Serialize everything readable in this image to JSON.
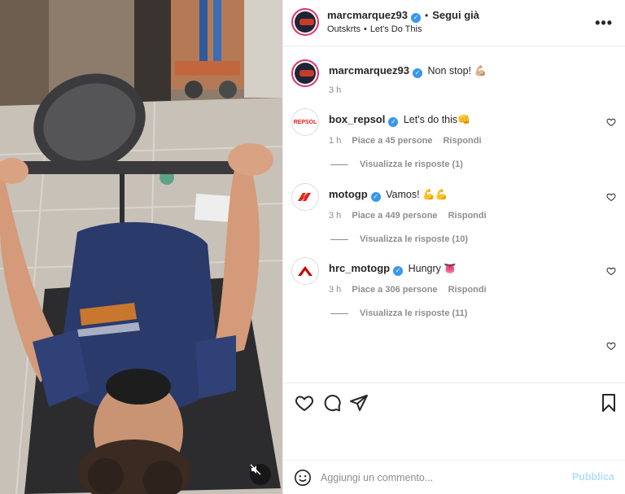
{
  "post": {
    "username": "marcmarquez93",
    "follow_label": "Segui già",
    "location": "Outskrts",
    "audio": "Let's Do This",
    "more_label": "•••"
  },
  "caption": {
    "username": "marcmarquez93",
    "text": "Non stop! 💪🏼",
    "time": "3 h"
  },
  "comments": [
    {
      "username": "box_repsol",
      "text": "Let's do this👊",
      "time": "1 h",
      "likes": "Piace a 45 persone",
      "reply": "Rispondi",
      "view_replies": "Visualizza le risposte (1)",
      "avatar_text": "REPSOL",
      "avatar_color": "#e2231a"
    },
    {
      "username": "motogp",
      "text": "Vamos! 💪💪",
      "time": "3 h",
      "likes": "Piace a 449 persone",
      "reply": "Rispondi",
      "view_replies": "Visualizza le risposte (10)",
      "avatar_text": "",
      "avatar_color": "#e2231a"
    },
    {
      "username": "hrc_motogp",
      "text": "Hungry 👅",
      "time": "3 h",
      "likes": "Piace a 306 persone",
      "reply": "Rispondi",
      "view_replies": "Visualizza le risposte (11)",
      "avatar_text": "",
      "avatar_color": "#cc0000"
    }
  ],
  "input": {
    "placeholder": "Aggiungi un commento...",
    "publish_label": "Pubblica"
  },
  "colors": {
    "verified": "#3897f0",
    "publish_disabled": "#b2dffc",
    "story_ring": "#e1306c"
  }
}
